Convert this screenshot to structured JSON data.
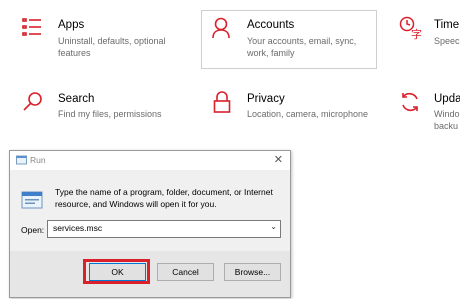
{
  "settings": {
    "tiles": {
      "apps": {
        "title": "Apps",
        "desc1": "Uninstall, defaults, optional",
        "desc2": "features"
      },
      "accounts": {
        "title": "Accounts",
        "desc1": "Your accounts, email, sync,",
        "desc2": "work, family"
      },
      "time": {
        "title": "Time &",
        "desc1": "Speech"
      },
      "search": {
        "title": "Search",
        "desc1": "Find my files, permissions"
      },
      "privacy": {
        "title": "Privacy",
        "desc1": "Location, camera, microphone"
      },
      "update": {
        "title": "Updat",
        "desc1": "Windo",
        "desc2": "backu"
      }
    },
    "icon_color": "#d9202b"
  },
  "run_dialog": {
    "title": "Run",
    "prompt_line1": "Type the name of a program, folder, document, or Internet",
    "prompt_line2": "resource, and Windows will open it for you.",
    "open_label": "Open:",
    "open_value": "services.msc",
    "buttons": {
      "ok": "OK",
      "cancel": "Cancel",
      "browse": "Browse..."
    },
    "highlight_color": "#d9202b"
  }
}
